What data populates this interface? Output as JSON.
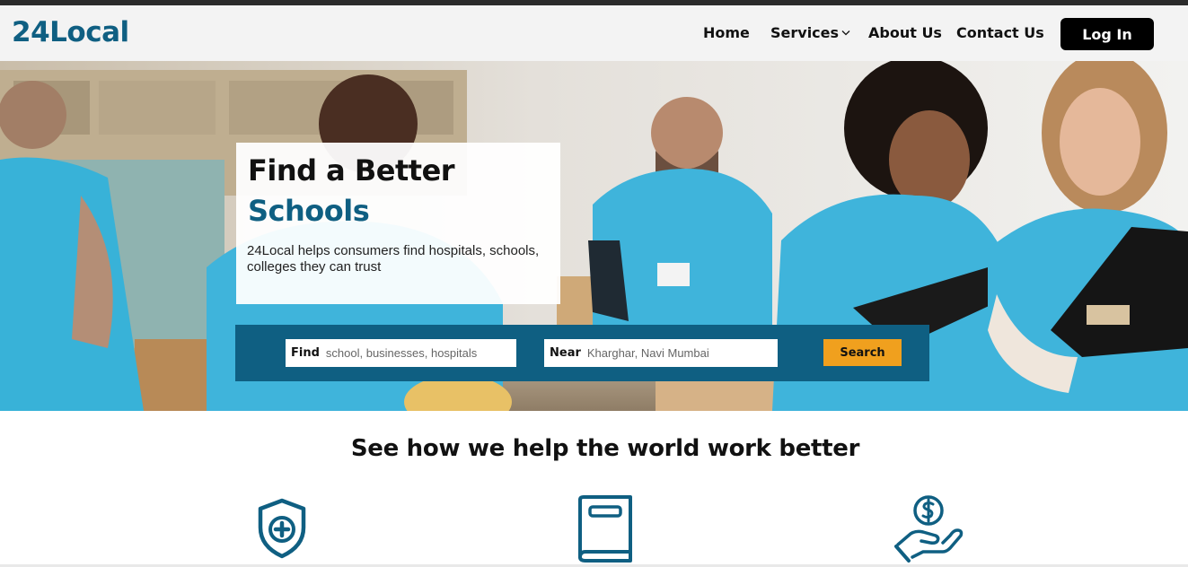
{
  "brand": {
    "logo": "24Local"
  },
  "nav": {
    "home": "Home",
    "services": "Services",
    "about": "About Us",
    "contact": "Contact Us",
    "login": "Log In"
  },
  "hero": {
    "title_line1": "Find a Better",
    "title_line2": "Schools",
    "description": "24Local helps consumers find hospitals, schools, colleges they can trust"
  },
  "search": {
    "find_label": "Find",
    "find_placeholder": "school, businesses, hospitals",
    "near_label": "Near",
    "near_placeholder": "Kharghar, Navi Mumbai",
    "button": "Search"
  },
  "section": {
    "title": "See how we help the world work better"
  },
  "features": [
    {
      "icon": "shield-plus-icon"
    },
    {
      "icon": "book-icon"
    },
    {
      "icon": "hand-dollar-icon"
    }
  ],
  "colors": {
    "brand_blue": "#0f5f82",
    "search_orange": "#f0a01e",
    "login_black": "#000000",
    "shirt_cyan": "#3fb4db"
  }
}
